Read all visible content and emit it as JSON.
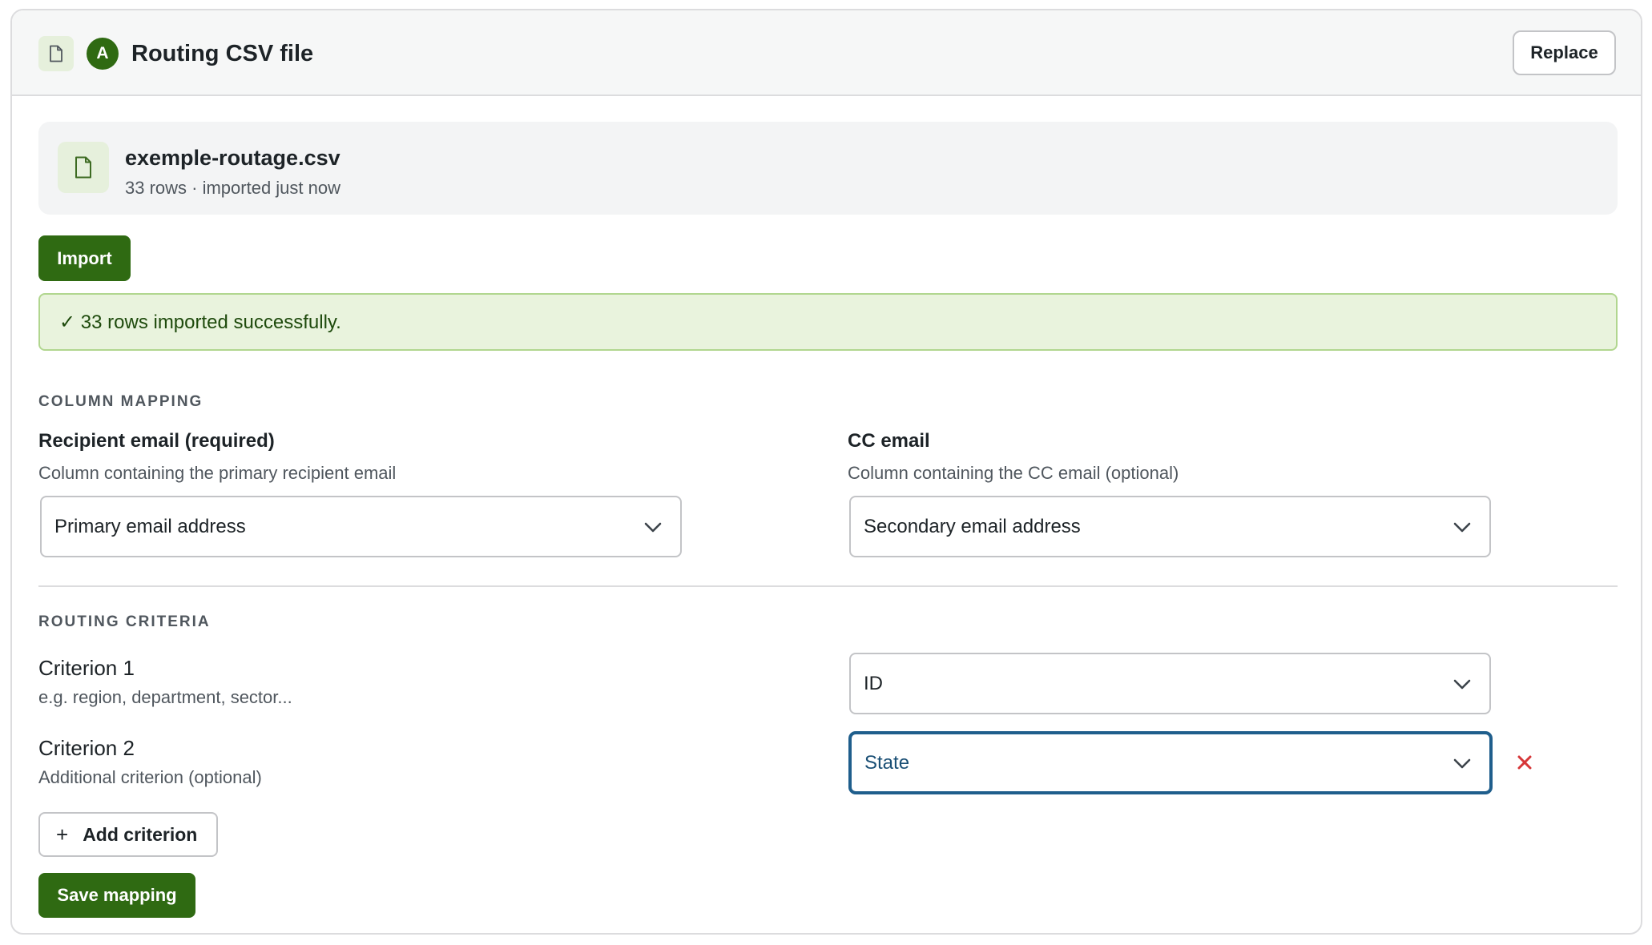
{
  "header": {
    "badge_letter": "A",
    "title": "Routing CSV file",
    "replace_label": "Replace"
  },
  "file": {
    "name": "exemple-routage.csv",
    "meta": "33 rows · imported just now"
  },
  "import_label": "Import",
  "success_message": "✓ 33 rows imported successfully.",
  "column_mapping": {
    "section_title": "COLUMN MAPPING",
    "recipient": {
      "label": "Recipient email (required)",
      "help": "Column containing the primary recipient email",
      "value": "Primary email address"
    },
    "cc": {
      "label": "CC email",
      "help": "Column containing the CC email (optional)",
      "value": "Secondary email address"
    }
  },
  "routing_criteria": {
    "section_title": "ROUTING CRITERIA",
    "criteria": [
      {
        "label": "Criterion 1",
        "help": "e.g. region, department, sector...",
        "value": "ID"
      },
      {
        "label": "Criterion 2",
        "help": "Additional criterion (optional)",
        "value": "State"
      }
    ],
    "add_label": "Add criterion",
    "save_label": "Save mapping"
  },
  "icons": {
    "header_file": "file-icon",
    "panel_file": "file-icon",
    "select_arrow": "chevron-down-icon",
    "remove": "close-icon",
    "add": "plus-icon"
  },
  "colors": {
    "primary_green": "#2f6a12",
    "success_bg": "#e9f3dd",
    "success_border": "#b1d68f",
    "focus_blue": "#1f5e8c",
    "danger_red": "#d63638"
  }
}
